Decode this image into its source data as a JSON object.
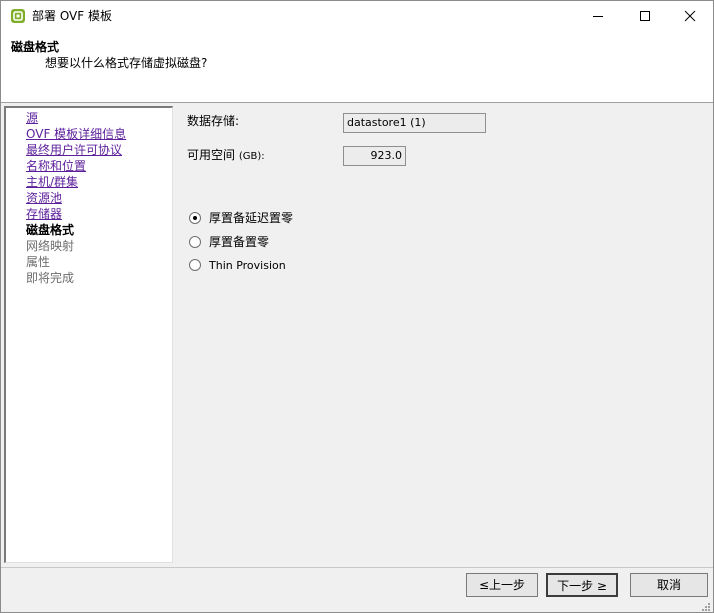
{
  "window": {
    "title": "部署 OVF 模板",
    "icon": "vsphere-logo-icon",
    "controls": [
      "minimize-icon",
      "maximize-icon",
      "close-icon"
    ]
  },
  "header": {
    "title": "磁盘格式",
    "subtitle": "想要以什么格式存储虚拟磁盘?"
  },
  "steps": [
    {
      "label": "源",
      "state": "done"
    },
    {
      "label": "OVF 模板详细信息",
      "state": "done"
    },
    {
      "label": "最终用户许可协议",
      "state": "done"
    },
    {
      "label": "名称和位置",
      "state": "done"
    },
    {
      "label": "主机/群集",
      "state": "done"
    },
    {
      "label": "资源池",
      "state": "done"
    },
    {
      "label": "存储器",
      "state": "done"
    },
    {
      "label": "磁盘格式",
      "state": "current"
    },
    {
      "label": "网络映射",
      "state": "future"
    },
    {
      "label": "属性",
      "state": "future"
    },
    {
      "label": "即将完成",
      "state": "future"
    }
  ],
  "main": {
    "datastore_label": "数据存储:",
    "datastore_value": "datastore1 (1)",
    "free_space_label": "可用空间",
    "free_space_unit": "(GB):",
    "free_space_value": "923.0",
    "options": [
      {
        "label": "厚置备延迟置零",
        "checked": true
      },
      {
        "label": "厚置备置零",
        "checked": false
      },
      {
        "label": "Thin Provision",
        "checked": false
      }
    ]
  },
  "footer": {
    "back_label": "≤上一步",
    "next_label": "下一步 ≥",
    "cancel_label": "取消"
  }
}
